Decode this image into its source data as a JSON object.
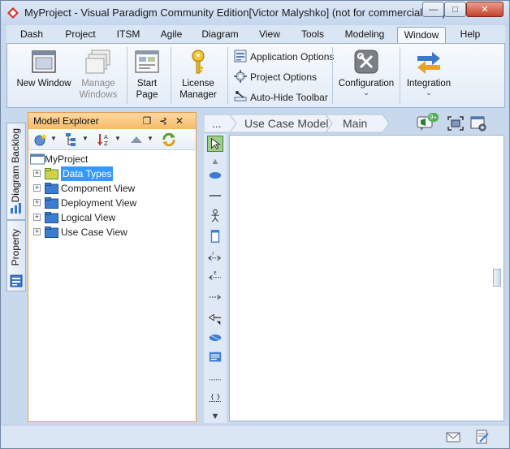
{
  "window": {
    "title": "MyProject - Visual Paradigm Community Edition[Victor Malyshko] (not for commercial use)",
    "minimize_glyph": "—",
    "maximize_glyph": "□",
    "close_glyph": "✕"
  },
  "menu": {
    "tabs": [
      "Dash",
      "Project",
      "ITSM",
      "Agile",
      "Diagram",
      "View",
      "Tools",
      "Modeling",
      "Window",
      "Help"
    ],
    "active_tab": "Window"
  },
  "ribbon": {
    "new_window": "New Window",
    "manage_windows": "Manage Windows",
    "start_page": "Start Page",
    "license_manager": "License Manager",
    "application_options": "Application Options",
    "project_options": "Project Options",
    "auto_hide_toolbar": "Auto-Hide Toolbar",
    "configuration": "Configuration",
    "integration": "Integration"
  },
  "side_tabs": {
    "diagram_backlog": "Diagram Backlog",
    "property": "Property"
  },
  "model_explorer": {
    "title": "Model Explorer",
    "root": "MyProject",
    "items": [
      "Data Types",
      "Component View",
      "Deployment View",
      "Logical View",
      "Use Case View"
    ],
    "selected": "Data Types"
  },
  "breadcrumb": {
    "more": "...",
    "items": [
      "Use Case Model",
      "Main"
    ]
  },
  "badges": {
    "notifications": "9+"
  },
  "colors": {
    "panel_header": "#f6ba67",
    "panel_border": "#e79a4c",
    "selection": "#3399ff",
    "window_frame": "#c9d9ed",
    "close_button": "#c4422a"
  }
}
